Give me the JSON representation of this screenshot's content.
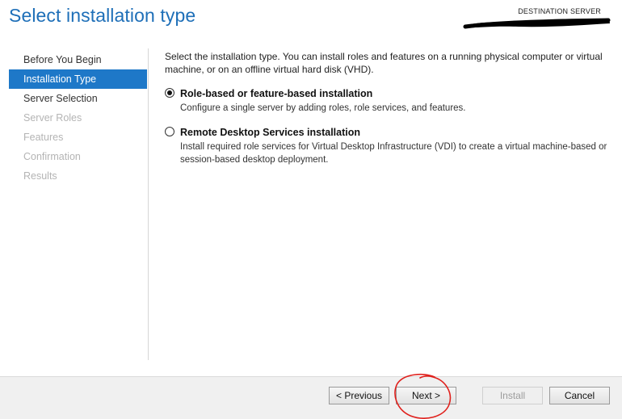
{
  "header": {
    "title": "Select installation type",
    "destination_label": "DESTINATION SERVER"
  },
  "sidebar": {
    "items": [
      {
        "label": "Before You Begin",
        "state": "normal"
      },
      {
        "label": "Installation Type",
        "state": "active"
      },
      {
        "label": "Server Selection",
        "state": "normal"
      },
      {
        "label": "Server Roles",
        "state": "disabled"
      },
      {
        "label": "Features",
        "state": "disabled"
      },
      {
        "label": "Confirmation",
        "state": "disabled"
      },
      {
        "label": "Results",
        "state": "disabled"
      }
    ]
  },
  "main": {
    "intro": "Select the installation type. You can install roles and features on a running physical computer or virtual machine, or on an offline virtual hard disk (VHD).",
    "options": [
      {
        "title": "Role-based or feature-based installation",
        "description": "Configure a single server by adding roles, role services, and features.",
        "selected": true
      },
      {
        "title": "Remote Desktop Services installation",
        "description": "Install required role services for Virtual Desktop Infrastructure (VDI) to create a virtual machine-based or session-based desktop deployment.",
        "selected": false
      }
    ]
  },
  "footer": {
    "previous_label": "< Previous",
    "next_label": "Next >",
    "install_label": "Install",
    "cancel_label": "Cancel",
    "install_enabled": false
  },
  "colors": {
    "title_blue": "#1e6fb8",
    "active_item_bg": "#1e78c8",
    "annotation_red": "#e0201c",
    "redaction": "#000000"
  }
}
